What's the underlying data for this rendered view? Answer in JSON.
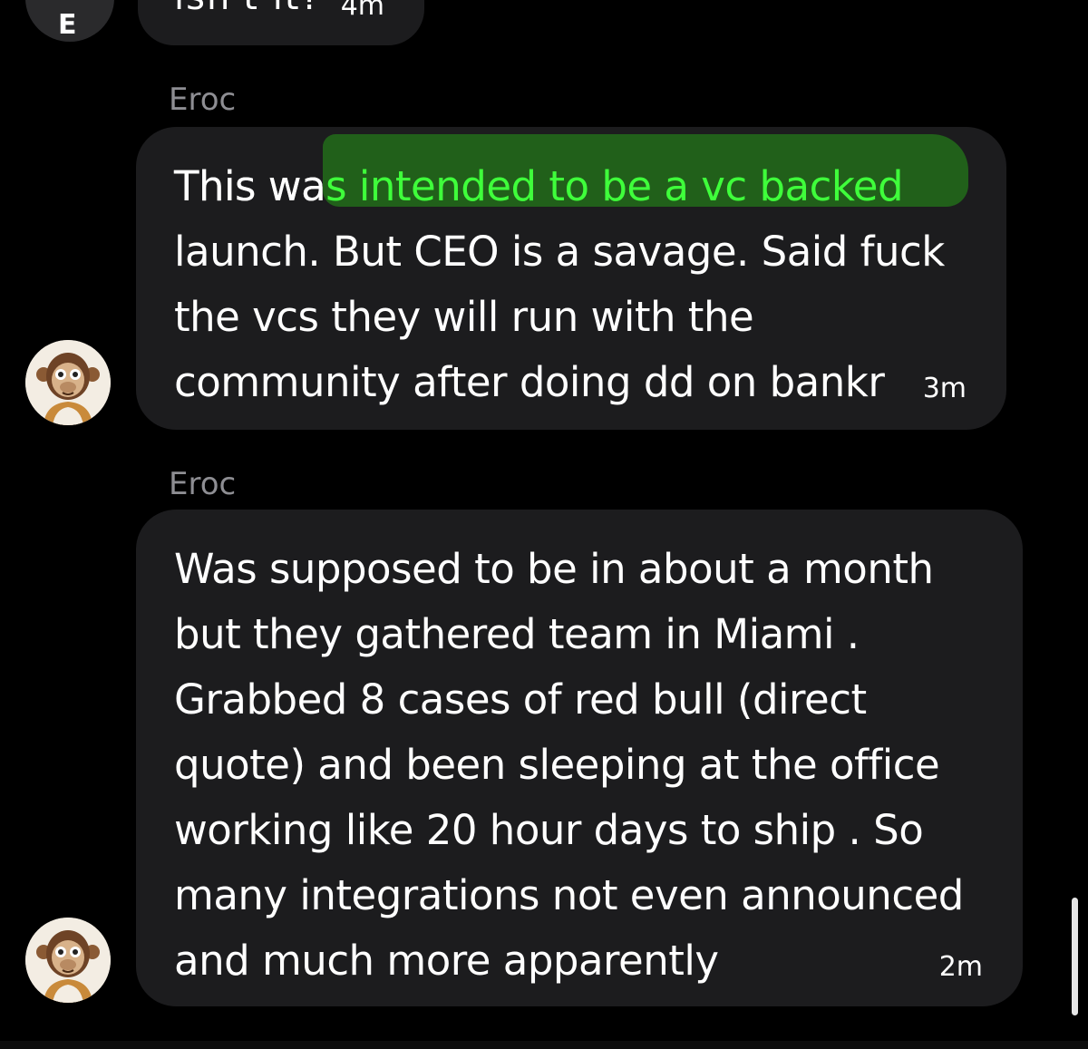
{
  "previous_message": {
    "partial_text": "isn't it?",
    "time": "4m",
    "avatar_letter": "E"
  },
  "messages": [
    {
      "sender": "Eroc",
      "text_before_highlight": "This wa",
      "text_highlight": "s intended to be a vc backed",
      "text_after": "launch. But CEO is a savage. Said fuck\nthe vcs they will run with the\ncommunity after doing dd on bankr",
      "time": "3m"
    },
    {
      "sender": "Eroc",
      "text": "Was supposed to be in about a month\nbut they gathered team in Miami .\nGrabbed 8 cases of red bull (direct\nquote) and been sleeping at the office\nworking like 20 hour days to ship . So\nmany integrations not even announced\nand much more apparently",
      "time": "2m"
    }
  ],
  "colors": {
    "background": "#000000",
    "bubble": "#1c1c1e",
    "sender": "#8e8e93",
    "highlight": "#22661a",
    "highlight_text": "#3fff3b"
  },
  "icons": {
    "avatar": "monkey-avatar-icon"
  }
}
